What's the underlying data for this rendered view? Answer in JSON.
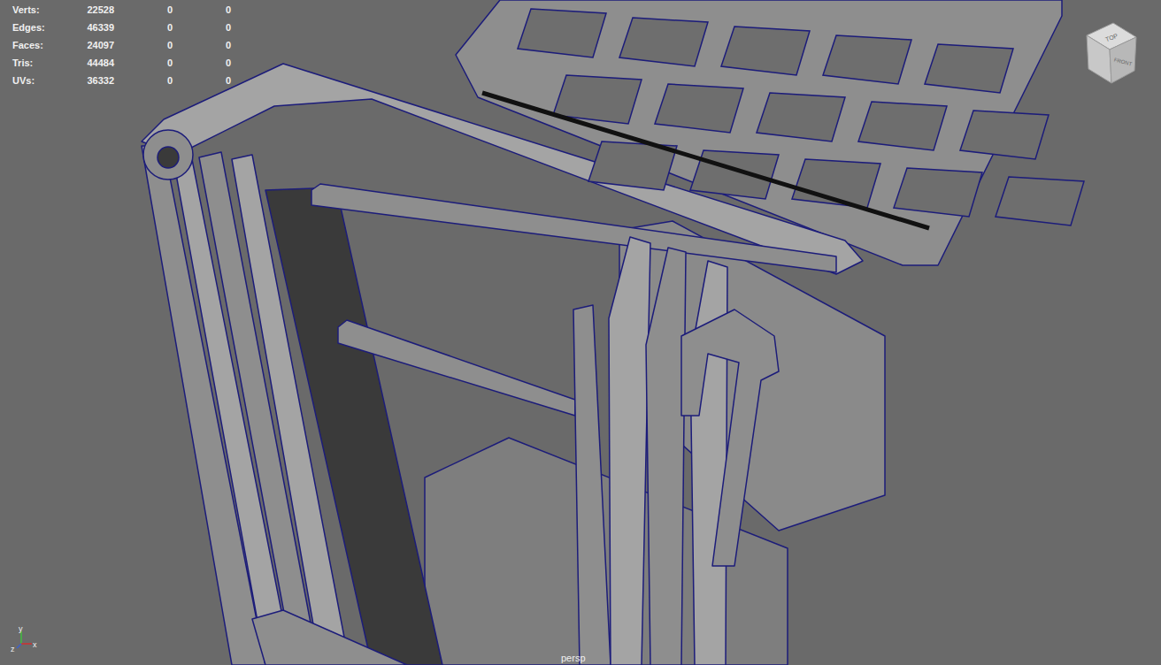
{
  "stats": [
    {
      "label": "Verts:",
      "values": [
        "22528",
        "0",
        "0"
      ]
    },
    {
      "label": "Edges:",
      "values": [
        "46339",
        "0",
        "0"
      ]
    },
    {
      "label": "Faces:",
      "values": [
        "24097",
        "0",
        "0"
      ]
    },
    {
      "label": "Tris:",
      "values": [
        "44484",
        "0",
        "0"
      ]
    },
    {
      "label": "UVs:",
      "values": [
        "36332",
        "0",
        "0"
      ]
    }
  ],
  "viewcube": {
    "top": "TOP",
    "front": "FRONT"
  },
  "camera": "persp",
  "axes": {
    "y": "y",
    "z": "z",
    "x": "x"
  }
}
